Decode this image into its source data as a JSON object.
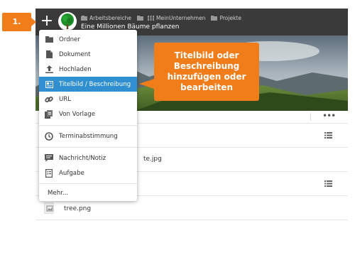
{
  "step_badge": "1.",
  "callout": {
    "lines": [
      "Titelbild oder",
      "Beschreibung",
      "hinzufügen oder",
      "bearbeiten"
    ]
  },
  "topbar": {
    "add_label": "+",
    "breadcrumb": [
      "Arbeitsbereiche",
      "MeinUnternehmen",
      "Projekte"
    ],
    "workspace_title": "Eine Millionen Bäume pflanzen"
  },
  "menu": {
    "items": [
      {
        "label": "Ordner",
        "icon": "folder-icon"
      },
      {
        "label": "Dokument",
        "icon": "document-icon"
      },
      {
        "label": "Hochladen",
        "icon": "upload-icon"
      },
      {
        "label": "Titelbild / Beschreibung",
        "icon": "image-icon",
        "active": true
      },
      {
        "label": "URL",
        "icon": "link-icon"
      },
      {
        "label": "Von Vorlage",
        "icon": "template-icon"
      },
      {
        "label": "Terminabstimmung",
        "icon": "clock-icon"
      },
      {
        "label": "Nachricht/Notiz",
        "icon": "message-icon"
      },
      {
        "label": "Aufgabe",
        "icon": "task-icon"
      },
      {
        "label": "Mehr..."
      }
    ]
  },
  "list": {
    "more_label": "•••",
    "files": [
      {
        "name": "te.jpg"
      },
      {
        "name": "tree.png"
      }
    ]
  },
  "colors": {
    "accent_orange": "#f07d1a",
    "menu_highlight": "#2f8fd0",
    "topbar": "#3a3a3a"
  }
}
